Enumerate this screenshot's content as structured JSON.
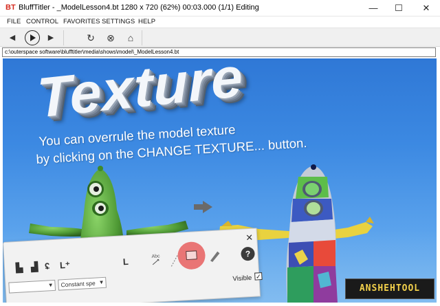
{
  "window": {
    "title": "BluffTitler - _ModelLesson4.bt 1280 x 720 (62%) 00:03.000 (1/1) Editing",
    "app_icon": "blufftitler-logo-icon",
    "controls": {
      "minimize": "—",
      "maximize": "☐",
      "close": "✕"
    }
  },
  "menu": {
    "items": [
      "FILE",
      "CONTROL",
      "FAVORITES",
      "SETTINGS",
      "HELP"
    ]
  },
  "toolbar": {
    "icons": [
      "rewind-icon",
      "play-icon",
      "forward-icon",
      "refresh-icon",
      "stop-icon",
      "home-icon"
    ],
    "glyphs": {
      "rewind": "◀",
      "forward": "▶",
      "refresh": "↻",
      "stop": "⊗",
      "home": "⌂"
    }
  },
  "path": {
    "value": "c:\\outerspace software\\blufftitler\\media\\shows\\model\\_ModelLesson4.bt"
  },
  "scene": {
    "title": "Texture",
    "subtitle_line1": "You can overrule the model texture",
    "subtitle_line2": "by clicking on the CHANGE TEXTURE... button.",
    "colors": {
      "sky_top": "#2f78d6",
      "sky_bottom": "#77b8f2",
      "monster_green": "#4f9a35",
      "arrow": "#6a6a6a"
    }
  },
  "panel": {
    "close": "✕",
    "select_1": "",
    "select_2": "Constant spe",
    "visible_label": "Visible",
    "visible_checked": true,
    "help": "?",
    "highlight_color": "#e86a6a"
  },
  "watermark": {
    "text": "ANSHEHTOOL"
  }
}
